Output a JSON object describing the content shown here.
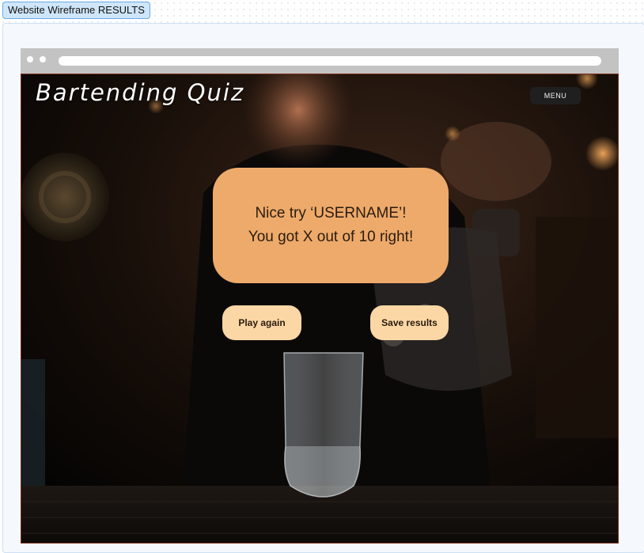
{
  "frame_label": "Website Wireframe RESULTS",
  "site": {
    "logo": "Bartending Quiz",
    "menu_label": "MENU"
  },
  "result": {
    "line1": "Nice try ‘USERNAME’!",
    "line2": "You got X out of 10 right!"
  },
  "actions": {
    "play_again": "Play again",
    "save_results": "Save results"
  },
  "colors": {
    "card": "#eeaa6a",
    "button": "#fbd7a5",
    "menu": "#1f1f1f",
    "frame_tag": "#cfe6fa"
  }
}
